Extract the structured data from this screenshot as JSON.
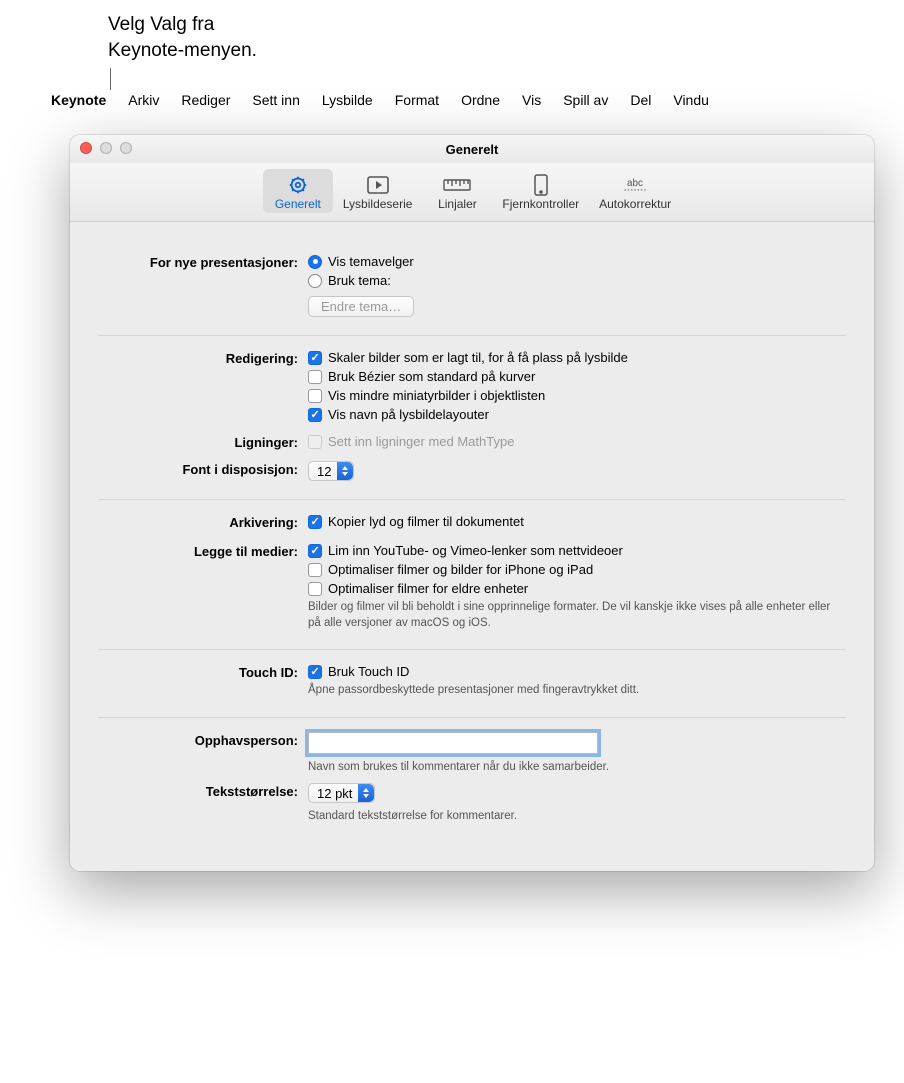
{
  "callout": "Velg Valg fra\nKeynote-menyen.",
  "menubar": [
    "Keynote",
    "Arkiv",
    "Rediger",
    "Sett inn",
    "Lysbilde",
    "Format",
    "Ordne",
    "Vis",
    "Spill av",
    "Del",
    "Vindu"
  ],
  "window_title": "Generelt",
  "toolbar": [
    {
      "label": "Generelt",
      "selected": true
    },
    {
      "label": "Lysbildeserie",
      "selected": false
    },
    {
      "label": "Linjaler",
      "selected": false
    },
    {
      "label": "Fjernkontroller",
      "selected": false
    },
    {
      "label": "Autokorrektur",
      "selected": false
    }
  ],
  "new_presentations": {
    "label": "For nye presentasjoner:",
    "option_show": "Vis temavelger",
    "option_use": "Bruk tema:",
    "change_button": "Endre tema…"
  },
  "editing": {
    "label": "Redigering:",
    "scale": "Skaler bilder som er lagt til, for å få plass på lysbilde",
    "bezier": "Bruk Bézier som standard på kurver",
    "thumbs": "Vis mindre miniatyrbilder i objektlisten",
    "layout": "Vis navn på lysbildelayouter"
  },
  "equations": {
    "label": "Ligninger:",
    "mathtype": "Sett inn ligninger med MathType"
  },
  "outline_font": {
    "label": "Font i disposisjon:",
    "value": "12"
  },
  "archiving": {
    "label": "Arkivering:",
    "copy": "Kopier lyd og filmer til dokumentet"
  },
  "media": {
    "label": "Legge til medier:",
    "paste": "Lim inn YouTube- og Vimeo-lenker som nettvideoer",
    "optimize_ios": "Optimaliser filmer og bilder for iPhone og iPad",
    "optimize_old": "Optimaliser filmer for eldre enheter",
    "hint": "Bilder og filmer vil bli beholdt i sine opprinnelige formater. De vil kanskje ikke vises på alle enheter eller på alle versjoner av macOS og iOS."
  },
  "touchid": {
    "label": "Touch ID:",
    "use": "Bruk Touch ID",
    "hint": "Åpne passordbeskyttede presentasjoner med fingeravtrykket ditt."
  },
  "author": {
    "label": "Opphavsperson:",
    "value": "",
    "hint": "Navn som brukes til kommentarer når du ikke samarbeider."
  },
  "textsize": {
    "label": "Tekststørrelse:",
    "value": "12 pkt",
    "hint": "Standard tekststørrelse for kommentarer."
  }
}
